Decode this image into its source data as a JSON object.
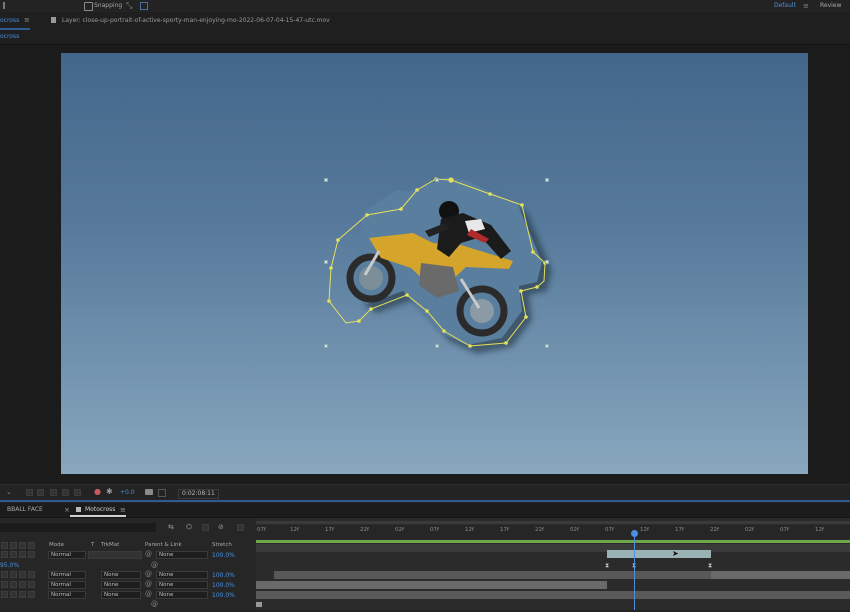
{
  "topbar": {
    "snapping_label": "Snapping",
    "workspace_default": "Default",
    "workspace_review": "Review"
  },
  "comp_panel": {
    "tab_label": "ocross",
    "layer_tab_title": "Layer: close-up-portrait-of-active-sporty-man-enjoying-mo-2022-06-07-04-15-47-utc.mov"
  },
  "viewer_bar": {
    "exposure_value": "+0.0",
    "timecode": "0:02:08:11"
  },
  "timeline": {
    "tabs": [
      {
        "label": "BBALL FACE"
      },
      {
        "label": "Motocross"
      }
    ],
    "columns": {
      "mode": "Mode",
      "t": "T",
      "trkmat": "TrkMat",
      "parent": "Parent & Link",
      "stretch": "Stretch"
    },
    "ruler_ticks": [
      "07f",
      "12f",
      "17f",
      "22f",
      "02f",
      "07f",
      "12f",
      "17f",
      "22f",
      "02f",
      "07f",
      "12f",
      "17f",
      "22f",
      "02f",
      "07f",
      "12f"
    ],
    "rows": [
      {
        "mode": "Normal",
        "trkmat": "",
        "parent": "None",
        "stretch": "100.0%"
      },
      {
        "left_value": "95.0%"
      },
      {
        "mode": "Normal",
        "trkmat": "None",
        "parent": "None",
        "stretch": "100.0%"
      },
      {
        "mode": "Normal",
        "trkmat": "None",
        "parent": "None",
        "stretch": "100.0%"
      },
      {
        "mode": "Normal",
        "trkmat": "None",
        "parent": "None",
        "stretch": "100.0%"
      }
    ]
  },
  "colors": {
    "accent": "#4a8fe0",
    "mask_path": "#e6e05a",
    "work_area": "#6ea64a"
  },
  "icons": [
    "snapping-checkbox",
    "rotate-tool-icon",
    "search-icon",
    "magnification-icon",
    "grid-icon",
    "camera-icon",
    "gear-icon",
    "menu-icon"
  ]
}
